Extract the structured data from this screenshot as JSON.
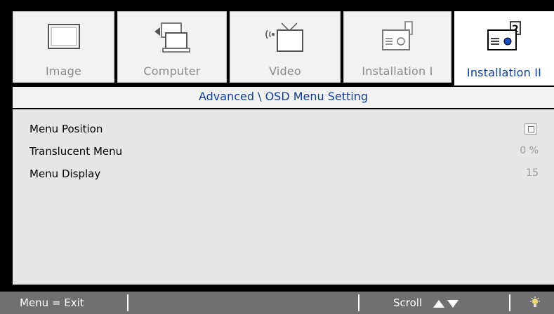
{
  "tabs": [
    {
      "label": "Image",
      "icon": "image-icon",
      "active": false
    },
    {
      "label": "Computer",
      "icon": "computer-icon",
      "active": false
    },
    {
      "label": "Video",
      "icon": "video-icon",
      "active": false
    },
    {
      "label": "Installation I",
      "icon": "installation-1-icon",
      "active": false
    },
    {
      "label": "Installation II",
      "icon": "installation-2-icon",
      "active": true
    }
  ],
  "submenu": {
    "title": "Advanced \\ OSD Menu Setting"
  },
  "settings": [
    {
      "label": "Menu Position",
      "value_icon": "menu-position-icon"
    },
    {
      "label": "Translucent Menu",
      "value": "0 %"
    },
    {
      "label": "Menu Display",
      "value": "15"
    }
  ],
  "footer": {
    "exit": "Menu = Exit",
    "scroll": "Scroll",
    "scroll_icon": "up-down-arrows-icon",
    "status_icon": "lamp-icon"
  },
  "colors": {
    "accent": "#0c3f9c",
    "footer_bg": "#707070",
    "content_bg": "#e6e6e6",
    "inactive_text": "#8a8a8a"
  }
}
